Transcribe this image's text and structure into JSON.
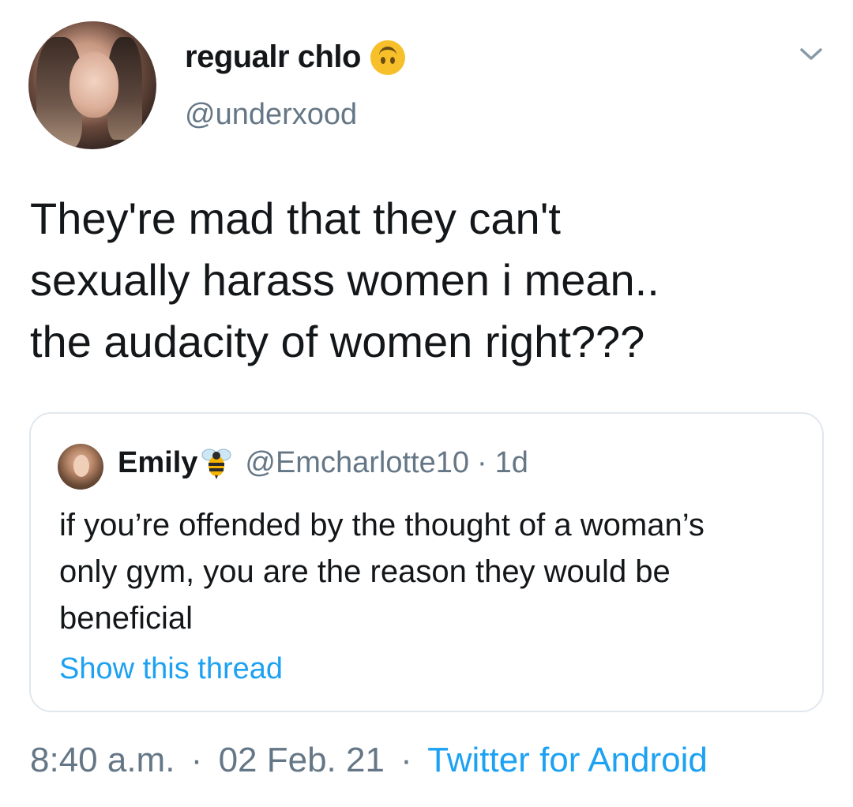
{
  "author": {
    "display_name": "regualr chlo",
    "name_emoji": "upside-down-face",
    "handle": "@underxood"
  },
  "tweet": {
    "text_lines": [
      "They're mad that they can't",
      "sexually harass women i mean..",
      "the audacity of women right???"
    ]
  },
  "quoted_tweet": {
    "display_name": "Emily",
    "name_emoji": "honeybee",
    "handle": "@Emcharlotte10",
    "separator": "·",
    "age": "1d",
    "text_lines": [
      "if you’re offended by the thought of a woman’s",
      "only gym, you are the reason they would be",
      "beneficial"
    ],
    "show_thread_label": "Show this thread"
  },
  "footer": {
    "time": "8:40 a.m.",
    "separator": "·",
    "date": "02 Feb. 21",
    "source": "Twitter for Android"
  },
  "colors": {
    "text_primary": "#14171a",
    "text_secondary": "#657786",
    "link": "#1da1f2",
    "border": "#e1e8ed"
  },
  "icons": [
    "caret-down-icon",
    "upside-down-face-emoji",
    "honeybee-emoji"
  ]
}
